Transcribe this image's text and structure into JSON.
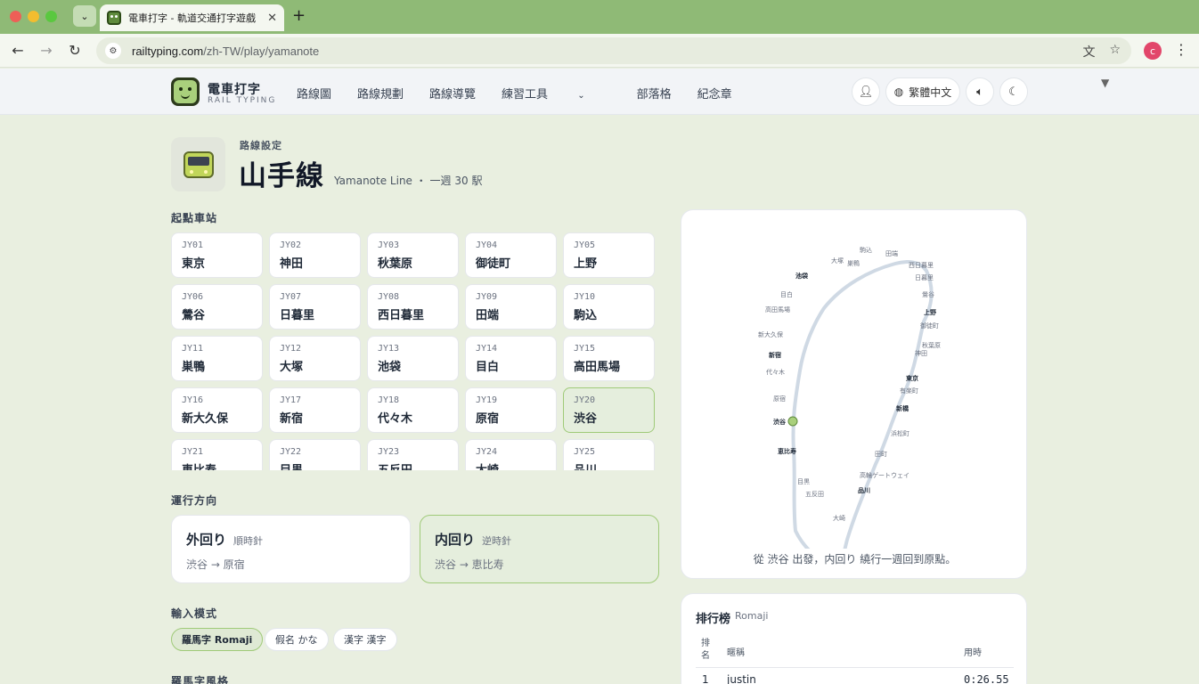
{
  "browser": {
    "tab_title": "電車打字 - 軌道交通打字遊戲",
    "url_host": "railtyping.com",
    "url_path": "/zh-TW/play/yamanote",
    "profile_initial": "c"
  },
  "header": {
    "logo_title": "電車打字",
    "logo_subtitle": "RAIL TYPING",
    "nav": [
      "路線圖",
      "路線規劃",
      "路線導覽",
      "練習工具",
      "部落格",
      "紀念章"
    ],
    "language": "繁體中文"
  },
  "hero": {
    "kicker": "路線設定",
    "title": "山手線",
    "subtitle": "Yamanote Line ・ 一週 30 駅"
  },
  "start_station": {
    "label": "起點車站",
    "selected_code": "JY20",
    "stations": [
      {
        "code": "JY01",
        "name": "東京"
      },
      {
        "code": "JY02",
        "name": "神田"
      },
      {
        "code": "JY03",
        "name": "秋葉原"
      },
      {
        "code": "JY04",
        "name": "御徒町"
      },
      {
        "code": "JY05",
        "name": "上野"
      },
      {
        "code": "JY06",
        "name": "鶯谷"
      },
      {
        "code": "JY07",
        "name": "日暮里"
      },
      {
        "code": "JY08",
        "name": "西日暮里"
      },
      {
        "code": "JY09",
        "name": "田端"
      },
      {
        "code": "JY10",
        "name": "駒込"
      },
      {
        "code": "JY11",
        "name": "巣鴨"
      },
      {
        "code": "JY12",
        "name": "大塚"
      },
      {
        "code": "JY13",
        "name": "池袋"
      },
      {
        "code": "JY14",
        "name": "目白"
      },
      {
        "code": "JY15",
        "name": "高田馬場"
      },
      {
        "code": "JY16",
        "name": "新大久保"
      },
      {
        "code": "JY17",
        "name": "新宿"
      },
      {
        "code": "JY18",
        "name": "代々木"
      },
      {
        "code": "JY19",
        "name": "原宿"
      },
      {
        "code": "JY20",
        "name": "渋谷"
      },
      {
        "code": "JY21",
        "name": "恵比寿"
      },
      {
        "code": "JY22",
        "name": "目黒"
      },
      {
        "code": "JY23",
        "name": "五反田"
      },
      {
        "code": "JY24",
        "name": "大崎"
      },
      {
        "code": "JY25",
        "name": "品川"
      }
    ]
  },
  "direction": {
    "label": "運行方向",
    "options": [
      {
        "title": "外回り",
        "hint": "順時針",
        "route": "渋谷 → 原宿",
        "selected": false
      },
      {
        "title": "内回り",
        "hint": "逆時針",
        "route": "渋谷 → 恵比寿",
        "selected": true
      }
    ]
  },
  "input_mode": {
    "label": "輸入模式",
    "options": [
      {
        "label": "羅馬字 Romaji",
        "selected": true
      },
      {
        "label": "假名 かな",
        "selected": false
      },
      {
        "label": "漢字 漢字",
        "selected": false
      }
    ]
  },
  "romaji_style": {
    "label": "羅馬字風格"
  },
  "map": {
    "caption": "從 渋谷 出發，内回り 繞行一週回到原點。",
    "station_labels": [
      {
        "name": "駒込",
        "bold": false
      },
      {
        "name": "田端",
        "bold": false
      },
      {
        "name": "大塚",
        "bold": false
      },
      {
        "name": "巣鴨",
        "bold": false
      },
      {
        "name": "西日暮里",
        "bold": false
      },
      {
        "name": "池袋",
        "bold": true
      },
      {
        "name": "日暮里",
        "bold": false
      },
      {
        "name": "目白",
        "bold": false
      },
      {
        "name": "鶯谷",
        "bold": false
      },
      {
        "name": "高田馬場",
        "bold": false
      },
      {
        "name": "上野",
        "bold": true
      },
      {
        "name": "御徒町",
        "bold": false
      },
      {
        "name": "新大久保",
        "bold": false
      },
      {
        "name": "秋葉原",
        "bold": false
      },
      {
        "name": "新宿",
        "bold": true
      },
      {
        "name": "神田",
        "bold": false
      },
      {
        "name": "代々木",
        "bold": false
      },
      {
        "name": "東京",
        "bold": true
      },
      {
        "name": "有楽町",
        "bold": false
      },
      {
        "name": "原宿",
        "bold": false
      },
      {
        "name": "新橋",
        "bold": true
      },
      {
        "name": "渋谷",
        "bold": true
      },
      {
        "name": "浜松町",
        "bold": false
      },
      {
        "name": "恵比寿",
        "bold": true
      },
      {
        "name": "田町",
        "bold": false
      },
      {
        "name": "高輪ゲートウェイ",
        "bold": false
      },
      {
        "name": "目黒",
        "bold": false
      },
      {
        "name": "品川",
        "bold": true
      },
      {
        "name": "五反田",
        "bold": false
      },
      {
        "name": "大崎",
        "bold": false
      }
    ]
  },
  "leaderboard": {
    "title": "排行榜",
    "mode": "Romaji",
    "col_rank": "排名",
    "col_name": "暱稱",
    "col_time": "用時",
    "rows": [
      {
        "rank": "1",
        "name": "justin",
        "time": "0:26.55"
      }
    ]
  }
}
